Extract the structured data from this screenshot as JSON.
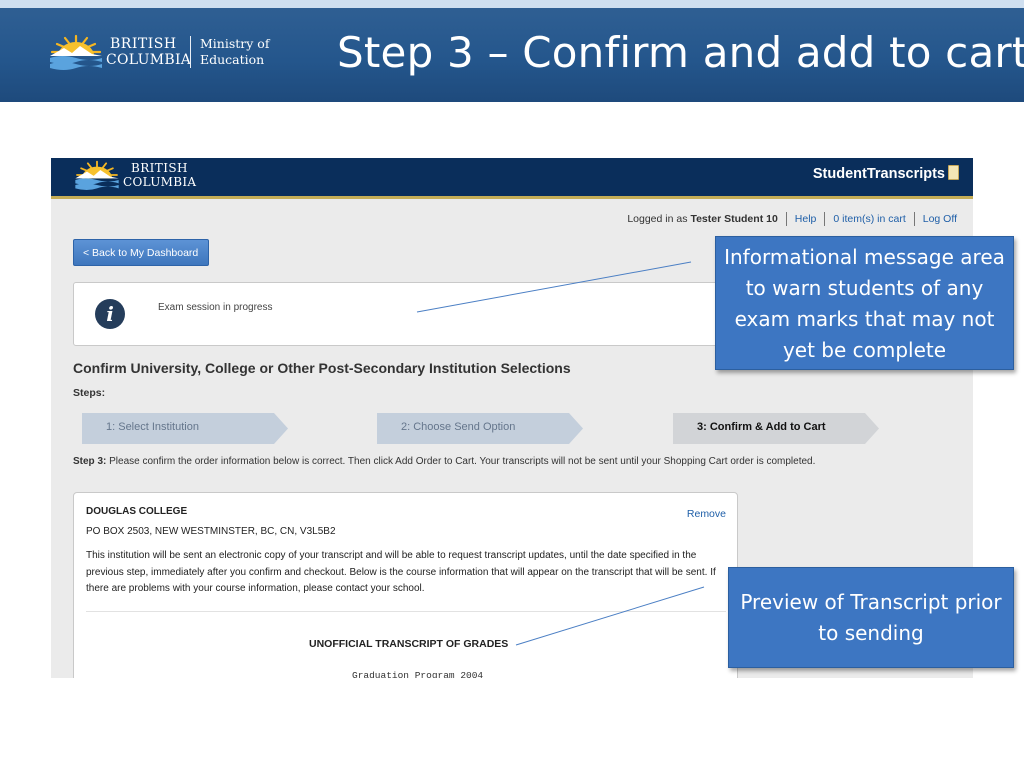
{
  "slide": {
    "title": "Step 3 – Confirm and add to cart",
    "logo": {
      "line1": "BRITISH",
      "line2": "COLUMBIA",
      "ministry": "Ministry of Education"
    }
  },
  "app": {
    "logo_line1": "BRITISH",
    "logo_line2": "COLUMBIA",
    "brand": "StudentTranscripts",
    "user_bar": {
      "logged_in_prefix": "Logged in as",
      "user_name": "Tester Student 10",
      "help": "Help",
      "cart": "0 item(s) in cart",
      "logoff": "Log Off"
    },
    "back_button": "< Back to My Dashboard",
    "info_message": "Exam session in progress",
    "section_title": "Confirm University, College or Other Post-Secondary Institution Selections",
    "steps_label": "Steps:",
    "steps": [
      {
        "label": "1: Select Institution",
        "state": "done"
      },
      {
        "label": "2: Choose Send Option",
        "state": "done"
      },
      {
        "label": "3: Confirm & Add to Cart",
        "state": "current"
      }
    ],
    "step_instruction_prefix": "Step 3:",
    "step_instruction": "Please confirm the order information below is correct. Then click Add Order to Cart. Your transcripts will not be sent until your Shopping Cart order is completed.",
    "order": {
      "institution": "DOUGLAS COLLEGE",
      "address": "PO BOX 2503, NEW WESTMINSTER, BC, CN, V3L5B2",
      "remove": "Remove",
      "description": "This institution will be sent an electronic copy of your transcript and will be able to request transcript updates, until the date specified in the previous step, immediately after you confirm and checkout. Below is the course information that will appear on the transcript that will be sent. If there are problems with your course information, please contact your school.",
      "transcript_title": "UNOFFICIAL TRANSCRIPT OF GRADES",
      "program": "Graduation Program 2004"
    }
  },
  "callouts": {
    "info_area": "Informational message area to warn students of any exam marks that may not yet be complete",
    "preview": "Preview of Transcript prior to sending"
  },
  "colors": {
    "header_blue": "#24568c",
    "app_navy": "#0a2e5b",
    "callout_blue": "#3d76c2",
    "link_blue": "#1f5fa8",
    "gold": "#c4ad56"
  }
}
